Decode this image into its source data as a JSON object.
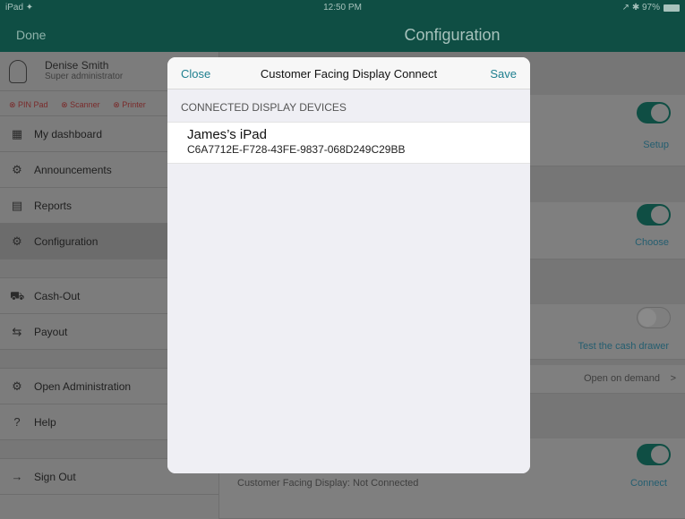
{
  "status_bar": {
    "device": "iPad ✦",
    "time": "12:50 PM",
    "right": "↗ ✱ 97%"
  },
  "nav": {
    "done": "Done",
    "title": "Configuration"
  },
  "user": {
    "name": "Denise Smith",
    "role": "Super administrator"
  },
  "devices": {
    "pin_pad": "PIN Pad",
    "scanner": "Scanner",
    "printer": "Printer"
  },
  "sidebar": {
    "items": [
      {
        "label": "My dashboard",
        "icon": "▦"
      },
      {
        "label": "Announcements",
        "icon": "⚙"
      },
      {
        "label": "Reports",
        "icon": "▤"
      },
      {
        "label": "Configuration",
        "icon": "⚙"
      },
      {
        "label": "Cash-Out",
        "icon": "⛟"
      },
      {
        "label": "Payout",
        "icon": "⇆"
      },
      {
        "label": "Open Administration",
        "icon": "⚙"
      },
      {
        "label": "Help",
        "icon": "?"
      },
      {
        "label": "Sign Out",
        "icon": "→"
      }
    ]
  },
  "main": {
    "setup": "Setup",
    "choose": "Choose",
    "test_drawer": "Test the cash drawer",
    "open_on_demand": "Open on demand",
    "cfd_status": "Customer Facing Display: Not Connected",
    "connect": "Connect"
  },
  "modal": {
    "close": "Close",
    "title": "Customer Facing Display Connect",
    "save": "Save",
    "section": "CONNECTED DISPLAY DEVICES",
    "device_name": "James’s iPad",
    "device_id": "C6A7712E-F728-43FE-9837-068D249C29BB"
  }
}
